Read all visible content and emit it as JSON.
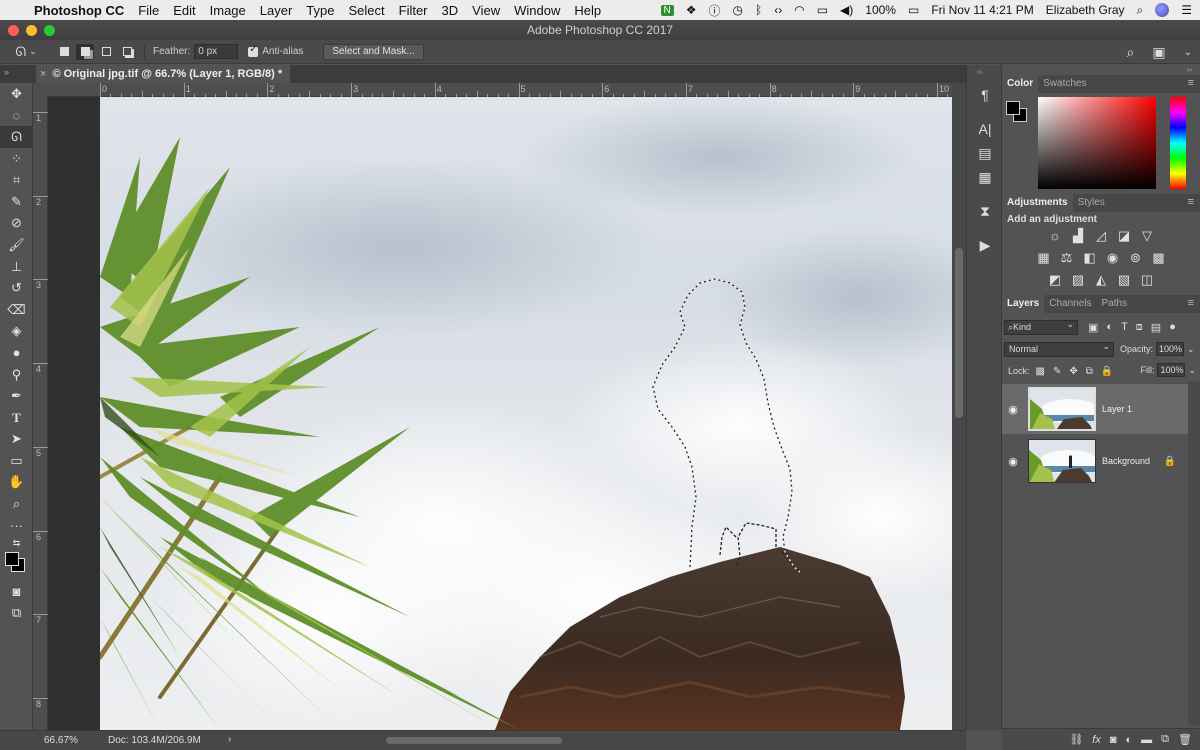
{
  "menubar": {
    "app_name": "Photoshop CC",
    "items": [
      "File",
      "Edit",
      "Image",
      "Layer",
      "Type",
      "Select",
      "Filter",
      "3D",
      "View",
      "Window",
      "Help"
    ],
    "battery": "100%",
    "datetime": "Fri Nov 11  4:21 PM",
    "user": "Elizabeth Gray"
  },
  "window": {
    "title": "Adobe Photoshop CC 2017"
  },
  "options": {
    "feather_label": "Feather:",
    "feather_value": "0 px",
    "antialias_label": "Anti-alias",
    "select_mask_label": "Select and Mask..."
  },
  "document": {
    "tab_title": "© Original jpg.tif @ 66.7% (Layer 1, RGB/8) *"
  },
  "rulers": {
    "horizontal": [
      "0",
      "1",
      "2",
      "3",
      "4",
      "5",
      "6",
      "7",
      "8",
      "9",
      "10"
    ],
    "vertical": [
      "1",
      "2",
      "3",
      "4",
      "5",
      "6",
      "7",
      "8"
    ]
  },
  "statusbar": {
    "zoom": "66.67%",
    "doc": "Doc: 103.4M/206.9M"
  },
  "color_panel": {
    "tabs": [
      "Color",
      "Swatches"
    ]
  },
  "adjustments_panel": {
    "tabs": [
      "Adjustments",
      "Styles"
    ],
    "add_label": "Add an adjustment"
  },
  "layers_panel": {
    "tabs": [
      "Layers",
      "Channels",
      "Paths"
    ],
    "kind_label": "Kind",
    "blend_mode": "Normal",
    "opacity_label": "Opacity:",
    "opacity_value": "100%",
    "lock_label": "Lock:",
    "fill_label": "Fill:",
    "fill_value": "100%",
    "layers": [
      {
        "name": "Layer 1"
      },
      {
        "name": "Background"
      }
    ]
  }
}
